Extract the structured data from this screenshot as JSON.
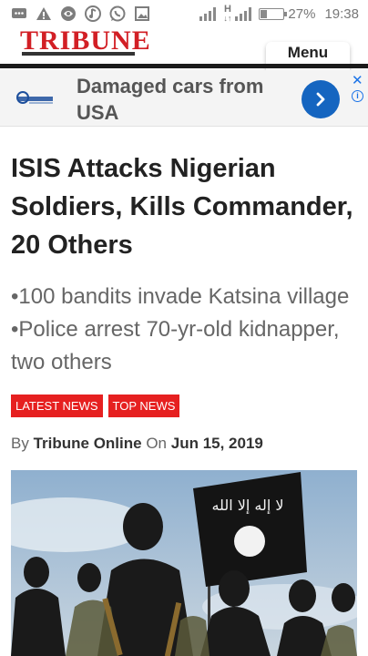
{
  "status_bar": {
    "battery": "27%",
    "time": "19:38",
    "network": "H",
    "network_sub": "↓↑",
    "icons": [
      "chat-icon",
      "warning-icon",
      "globe-icon",
      "music-icon",
      "whatsapp-icon",
      "image-icon"
    ]
  },
  "header": {
    "logo": "TRIBUNE",
    "menu_label": "Menu",
    "brand_color": "#d21f25"
  },
  "ad": {
    "headline": "Damaged cars from USA",
    "close": "✕",
    "info": "i",
    "cta_icon": "chevron-right-icon",
    "accent": "#1565c0"
  },
  "article": {
    "title": "ISIS Attacks Nigerian Soldiers, Kills Commander, 20 Others",
    "subhead": "•100 bandits invade Katsina village •Police arrest 70-yr-old kidnapper, two others",
    "tags": [
      "LATEST NEWS",
      "TOP NEWS"
    ],
    "tag_color": "#e62020",
    "byline": {
      "by": "By",
      "author": "Tribune Online",
      "on": "On",
      "date": "Jun 15, 2019"
    },
    "flag_text": "لا إله إلا الله"
  }
}
